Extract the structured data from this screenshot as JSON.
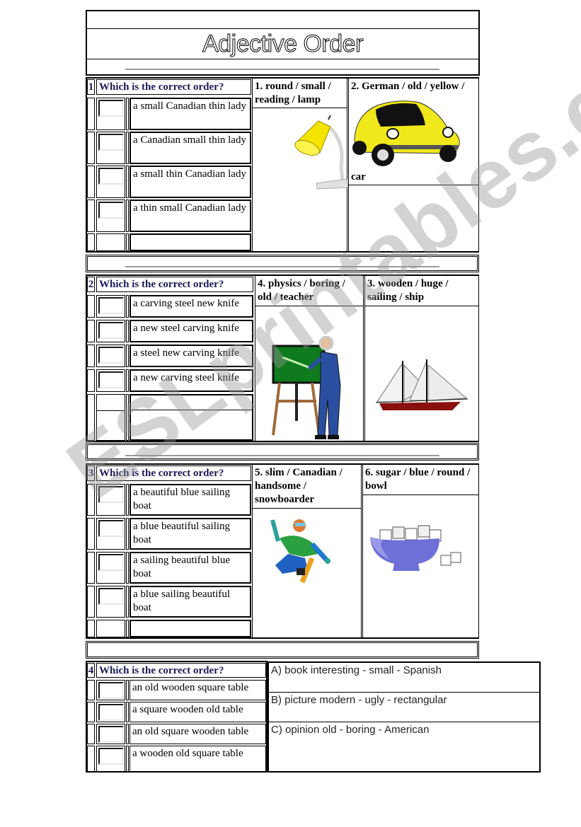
{
  "title": "Adjective Order",
  "sections": [
    {
      "number": "1",
      "question": "Which is the correct order?",
      "options": [
        "a small Canadian thin lady",
        "a Canadian small thin lady",
        "a small thin Canadian lady",
        "a thin small Canadian lady"
      ],
      "prompts": [
        {
          "text": "1. round / small / reading / lamp",
          "image": "lamp-image"
        },
        {
          "text": "2. German / old / yellow /",
          "trailing": "car",
          "image": "car-image"
        }
      ]
    },
    {
      "number": "2",
      "question": "Which is the correct order?",
      "options": [
        "a carving steel new knife",
        "a new steel carving knife",
        "a steel new carving knife",
        "a new carving steel knife"
      ],
      "prompts": [
        {
          "text": "4. physics / boring / old / teacher",
          "image": "teacher-image"
        },
        {
          "text": "3. wooden / huge / sailing / ship",
          "image": "ship-image"
        }
      ]
    },
    {
      "number": "3",
      "question": "Which is the correct order?",
      "options": [
        "a beautiful blue sailing boat",
        "a blue beautiful sailing boat",
        "a sailing beautiful blue boat",
        "a blue sailing beautiful boat"
      ],
      "prompts": [
        {
          "text": "5. slim / Canadian / handsome / snowboarder",
          "image": "snowboarder-image"
        },
        {
          "text": "6. sugar / blue / round / bowl",
          "image": "sugar-bowl-image"
        }
      ]
    },
    {
      "number": "4",
      "question": "Which is the correct order?",
      "options": [
        "an old wooden square table",
        "a square wooden old table",
        "an old square wooden table",
        "a wooden old square table"
      ],
      "answers": [
        "A)  book interesting - small - Spanish",
        "B) picture modern - ugly - rectangular",
        "C) opinion old - boring - American"
      ]
    }
  ],
  "watermark": "ESLprintables.com",
  "colors": {
    "question_text": "#1a1a5a",
    "divider": "#9a9a9a",
    "lamp": "#f5e400",
    "car": "#f0e81a",
    "chalkboard": "#0f7a1e",
    "ship_hull": "#8a1010",
    "bowl": "#6f6fd8"
  }
}
